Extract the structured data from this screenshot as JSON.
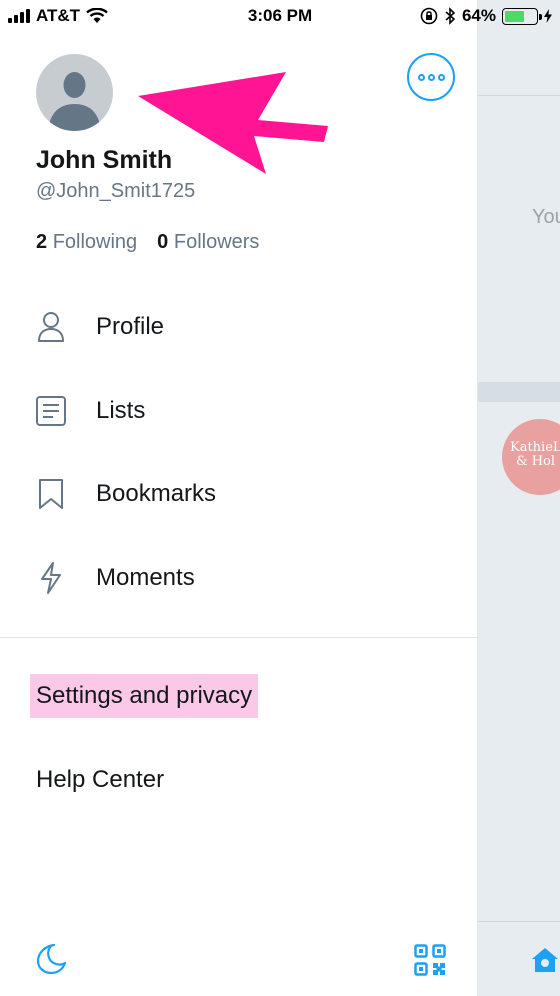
{
  "status_bar": {
    "carrier": "AT&T",
    "time": "3:06 PM",
    "battery_percent": "64%",
    "battery_level": 0.64
  },
  "profile": {
    "display_name": "John Smith",
    "handle": "@John_Smit1725",
    "following_count": "2",
    "following_label": "Following",
    "followers_count": "0",
    "followers_label": "Followers"
  },
  "menu": {
    "items": [
      {
        "label": "Profile",
        "icon": "person-icon"
      },
      {
        "label": "Lists",
        "icon": "list-icon"
      },
      {
        "label": "Bookmarks",
        "icon": "bookmark-icon"
      },
      {
        "label": "Moments",
        "icon": "lightning-icon"
      }
    ],
    "settings_label": "Settings and privacy",
    "help_label": "Help Center"
  },
  "background": {
    "partial_text": "You",
    "avatar_text_line1": "KathieL",
    "avatar_text_line2": "& Hol"
  },
  "colors": {
    "accent": "#1da1f2",
    "annotation_arrow": "#ff1493",
    "highlight": "#fbc8e8",
    "secondary_text": "#657786"
  }
}
